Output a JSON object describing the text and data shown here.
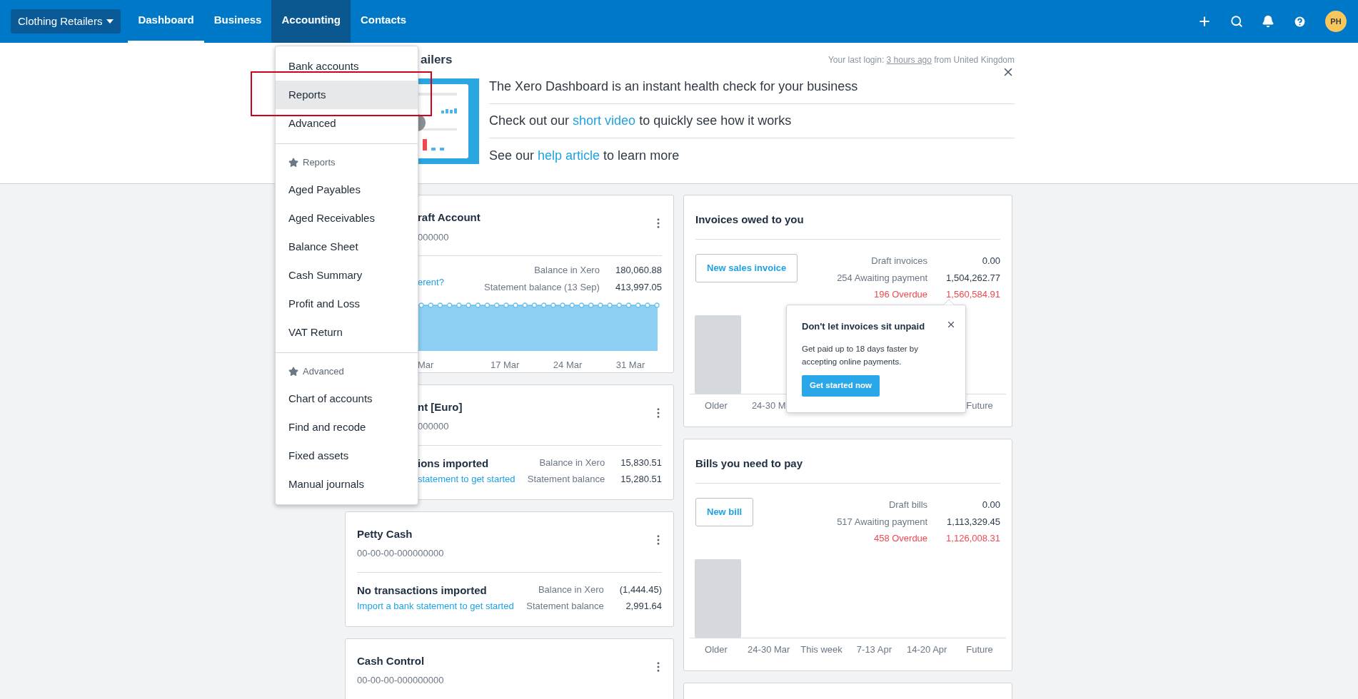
{
  "nav": {
    "org_switcher": "Clothing Retailers",
    "avatar": "PH",
    "tabs": [
      {
        "label": "Dashboard",
        "selected": true,
        "open": false
      },
      {
        "label": "Business",
        "selected": false,
        "open": false
      },
      {
        "label": "Accounting",
        "selected": false,
        "open": true
      },
      {
        "label": "Contacts",
        "selected": false,
        "open": false
      }
    ]
  },
  "menu": {
    "sections": [
      {
        "items": [
          {
            "label": "Bank accounts",
            "selected": false
          },
          {
            "label": "Reports",
            "selected": true
          },
          {
            "label": "Advanced",
            "selected": false
          }
        ]
      },
      {
        "heading": "Reports",
        "items": [
          {
            "label": "Aged Payables",
            "selected": false
          },
          {
            "label": "Aged Receivables",
            "selected": false
          },
          {
            "label": "Balance Sheet",
            "selected": false
          },
          {
            "label": "Cash Summary",
            "selected": false
          },
          {
            "label": "Profit and Loss",
            "selected": false
          },
          {
            "label": "VAT Return",
            "selected": false
          }
        ]
      },
      {
        "heading": "Advanced",
        "items": [
          {
            "label": "Chart of accounts",
            "selected": false
          },
          {
            "label": "Find and recode",
            "selected": false
          },
          {
            "label": "Fixed assets",
            "selected": false
          },
          {
            "label": "Manual journals",
            "selected": false
          }
        ]
      }
    ]
  },
  "annotation": {
    "kind": "outline"
  },
  "banner": {
    "title": "ailers",
    "last_login": {
      "before": "Your last login: ",
      "link": "3 hours ago",
      "after": " from United Kingdom"
    },
    "lines": [
      {
        "before": "The Xero Dashboard is an instant health check for your business"
      },
      {
        "before": "Check out our ",
        "link": "short video",
        "after": " to quickly see how it works"
      },
      {
        "before": "See our ",
        "link": "help article",
        "after": " to learn more"
      }
    ]
  },
  "bank_accounts": [
    {
      "kind": "chart",
      "partly_hidden": true,
      "title": "raft Account",
      "number": "000000",
      "link": "erent?",
      "stats": [
        {
          "label": "Balance in Xero",
          "value": "180,060.88"
        },
        {
          "label": "Statement balance (13 Sep)",
          "value": "413,997.05"
        }
      ],
      "axis_labels": [
        "Mar",
        "17 Mar",
        "24 Mar",
        "31 Mar"
      ]
    },
    {
      "kind": "no_feed",
      "partly_hidden": true,
      "title": "nt [Euro]",
      "number": "000000",
      "heading": "ions imported",
      "link": "statement to get started",
      "stats": [
        {
          "label": "Balance in Xero",
          "value": "15,830.51"
        },
        {
          "label": "Statement balance",
          "value": "15,280.51"
        }
      ]
    },
    {
      "kind": "no_feed",
      "partly_hidden": false,
      "title": "Petty Cash",
      "number": "00-00-00-000000000",
      "heading": "No transactions imported",
      "link": "Import a bank statement to get started",
      "stats": [
        {
          "label": "Balance in Xero",
          "value": "(1,444.45)"
        },
        {
          "label": "Statement balance",
          "value": "2,991.64"
        }
      ]
    },
    {
      "kind": "header_only",
      "partly_hidden": false,
      "title": "Cash Control",
      "number": "00-00-00-000000000"
    }
  ],
  "money_cards": [
    {
      "title": "Invoices owed to you",
      "button": "New sales invoice",
      "stats": [
        {
          "label": "Draft invoices",
          "value": "0.00",
          "alert": false
        },
        {
          "label": "254 Awaiting payment",
          "value": "1,504,262.77",
          "alert": false
        },
        {
          "label": "196 Overdue",
          "value": "1,560,584.91",
          "alert": true
        }
      ],
      "axis_labels": [
        "Older",
        "24-30 M",
        "Future"
      ],
      "popover": {
        "title": "Don't let invoices sit unpaid",
        "body": "Get paid up to 18 days faster by accepting online payments.",
        "button": "Get started now"
      }
    },
    {
      "title": "Bills you need to pay",
      "button": "New bill",
      "stats": [
        {
          "label": "Draft bills",
          "value": "0.00",
          "alert": false
        },
        {
          "label": "517 Awaiting payment",
          "value": "1,113,329.45",
          "alert": false
        },
        {
          "label": "458 Overdue",
          "value": "1,126,008.31",
          "alert": true
        }
      ],
      "axis_labels": [
        "Older",
        "24-30 Mar",
        "This week",
        "7-13 Apr",
        "14-20 Apr",
        "Future"
      ]
    }
  ]
}
